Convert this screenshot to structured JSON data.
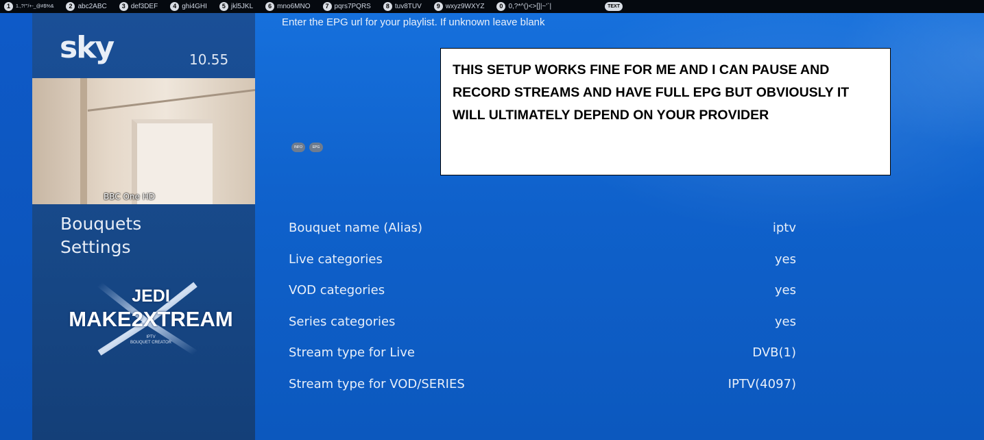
{
  "keystrip": {
    "keys": [
      {
        "num": "1",
        "label": "1.,?!'\"/+-_@#$%&"
      },
      {
        "num": "2",
        "label": "abc2ABC"
      },
      {
        "num": "3",
        "label": "def3DEF"
      },
      {
        "num": "4",
        "label": "ghi4GHI"
      },
      {
        "num": "5",
        "label": "jkl5JKL"
      },
      {
        "num": "6",
        "label": "mno6MNO"
      },
      {
        "num": "7",
        "label": "pqrs7PQRS"
      },
      {
        "num": "8",
        "label": "tuv8TUV"
      },
      {
        "num": "9",
        "label": "wxyz9WXYZ"
      },
      {
        "num": "0",
        "label": "0,?*^()<>[]|~'`|"
      }
    ],
    "text_key": "TEXT"
  },
  "sidebar": {
    "logo": "sky",
    "clock": "10.55",
    "channel": "BBC One HD",
    "menu_title_line1": "Bouquets",
    "menu_title_line2": "Settings",
    "brand_line1": "JEDI",
    "brand_line2": "MAKE2XTREAM",
    "brand_sub1": "IPTV",
    "brand_sub2": "BOUQUET CREATOR"
  },
  "main": {
    "hint": "Enter the EPG url for your playlist. If unknown leave blank",
    "icons": [
      {
        "label": "INFO"
      },
      {
        "label": "EPG"
      }
    ],
    "note": "THIS SETUP WORKS FINE FOR ME AND I CAN PAUSE AND RECORD STREAMS AND HAVE FULL EPG BUT OBVIOUSLY IT WILL ULTIMATELY DEPEND ON YOUR PROVIDER"
  },
  "settings": [
    {
      "label": "Bouquet name (Alias)",
      "value": "iptv"
    },
    {
      "label": "Live categories",
      "value": "yes"
    },
    {
      "label": "VOD categories",
      "value": "yes"
    },
    {
      "label": "Series categories",
      "value": "yes"
    },
    {
      "label": "Stream type for Live",
      "value": "DVB(1)"
    },
    {
      "label": "Stream type for VOD/SERIES",
      "value": "IPTV(4097)"
    }
  ]
}
